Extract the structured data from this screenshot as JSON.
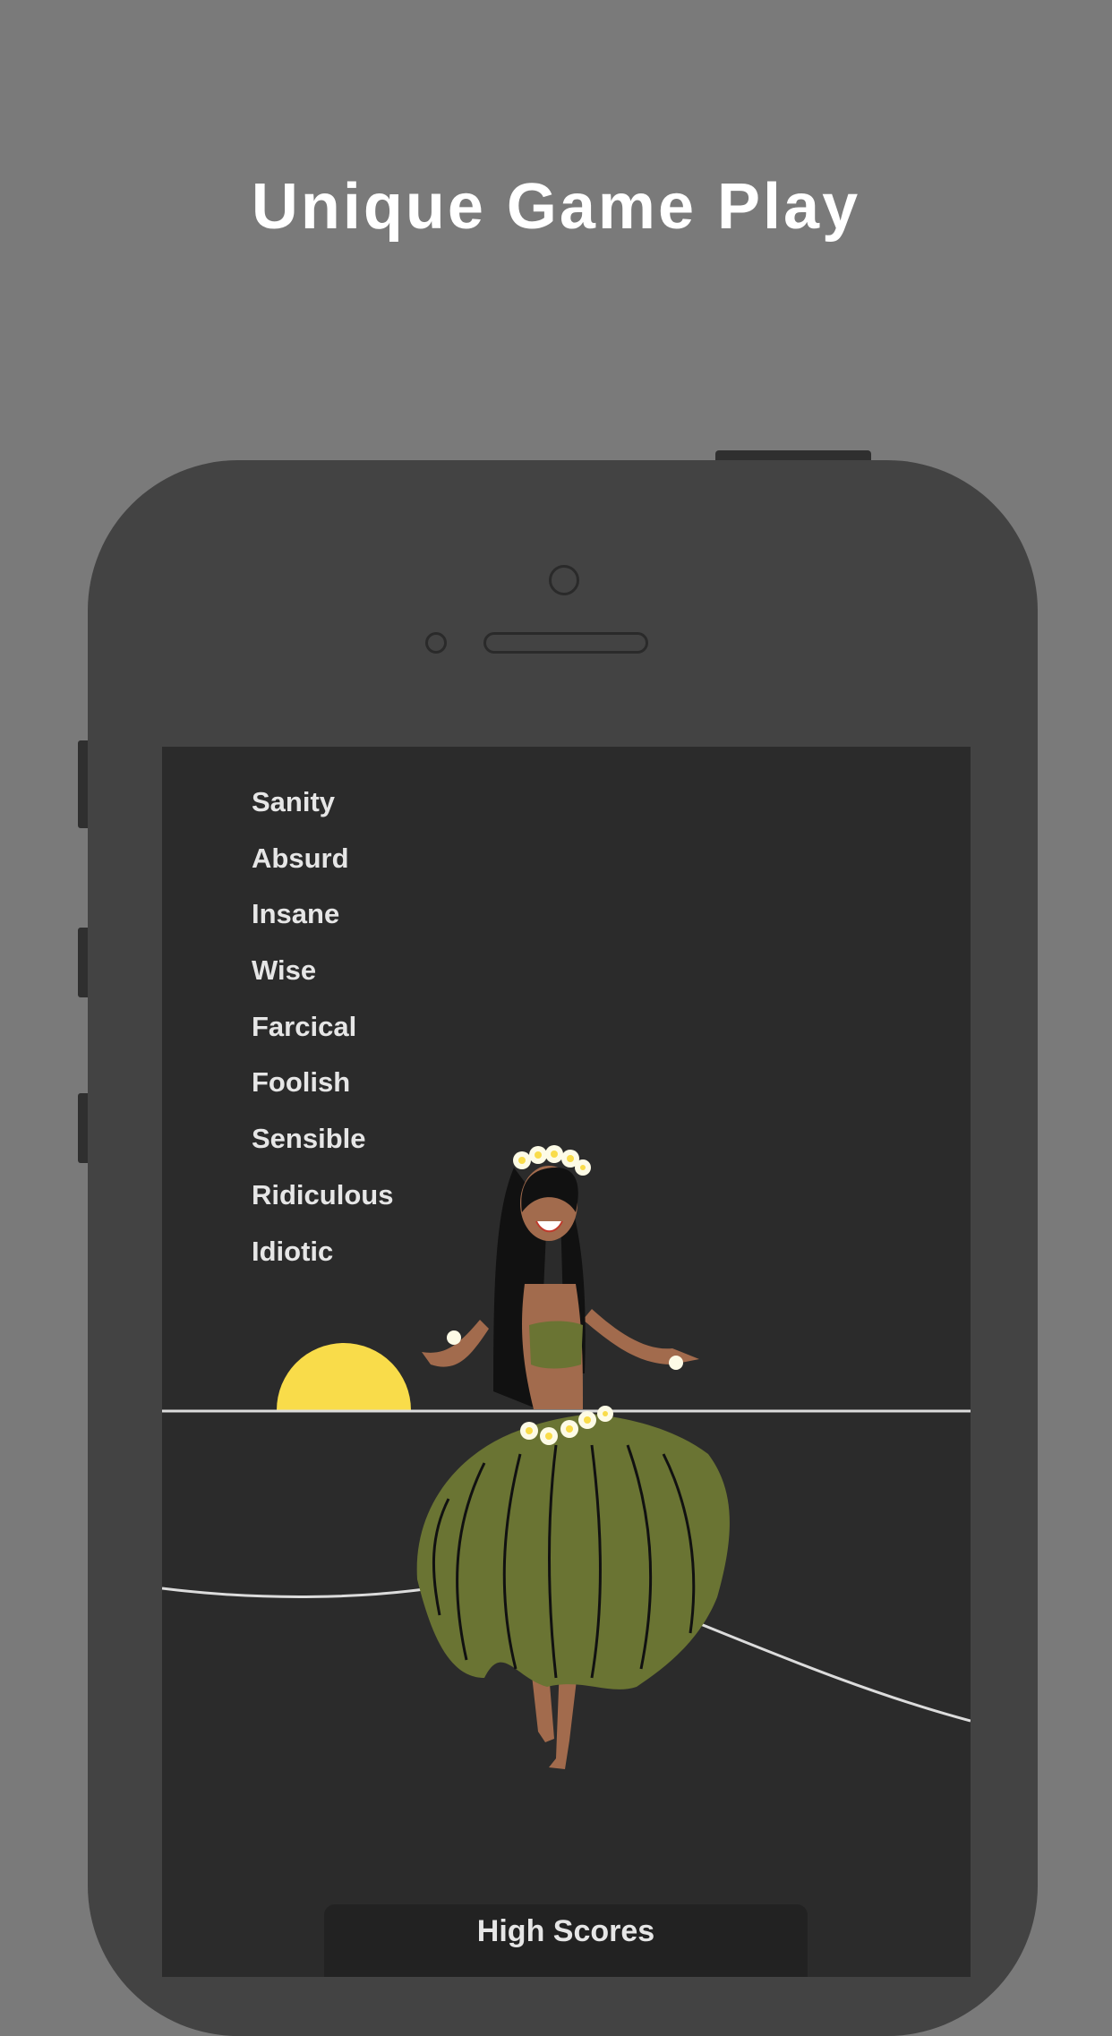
{
  "headline": "Unique Game Play",
  "game": {
    "words": [
      "Sanity",
      "Absurd",
      "Insane",
      "Wise",
      "Farcical",
      "Foolish",
      "Sensible",
      "Ridiculous",
      "Idiotic"
    ],
    "high_scores_label": "High Scores"
  },
  "colors": {
    "background": "#7a7a7a",
    "phone_body": "#434343",
    "screen": "#2b2b2b",
    "sun": "#f9dc4a",
    "skirt": "#6a7433",
    "skin": "#a26b4d",
    "hair": "#111111"
  }
}
